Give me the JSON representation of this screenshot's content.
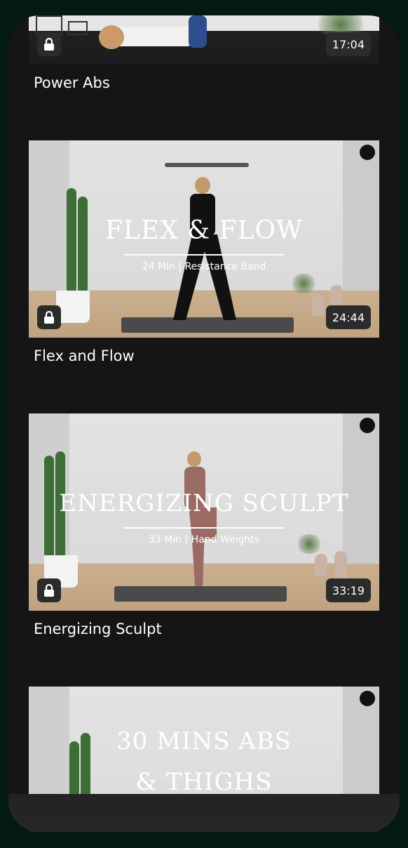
{
  "workouts": [
    {
      "title": "Power Abs",
      "duration": "17:04",
      "locked": true
    },
    {
      "title": "Flex and Flow",
      "duration": "24:44",
      "locked": true,
      "overlay_title": "FLEX & FLOW",
      "overlay_subtitle": "24 Min | Resistance Band"
    },
    {
      "title": "Energizing Sculpt",
      "duration": "33:19",
      "locked": true,
      "overlay_title": "ENERGIZING SCULPT",
      "overlay_subtitle": "33 Min | Hand Weights"
    },
    {
      "overlay_title_line1": "30 MINS ABS",
      "overlay_title_line2": "& THIGHS"
    }
  ],
  "icons": {
    "lock": "lock-icon",
    "brand": "brand-logo-icon"
  },
  "colors": {
    "background": "#151515",
    "badge": "#2b2b2b",
    "text": "#ffffff"
  }
}
